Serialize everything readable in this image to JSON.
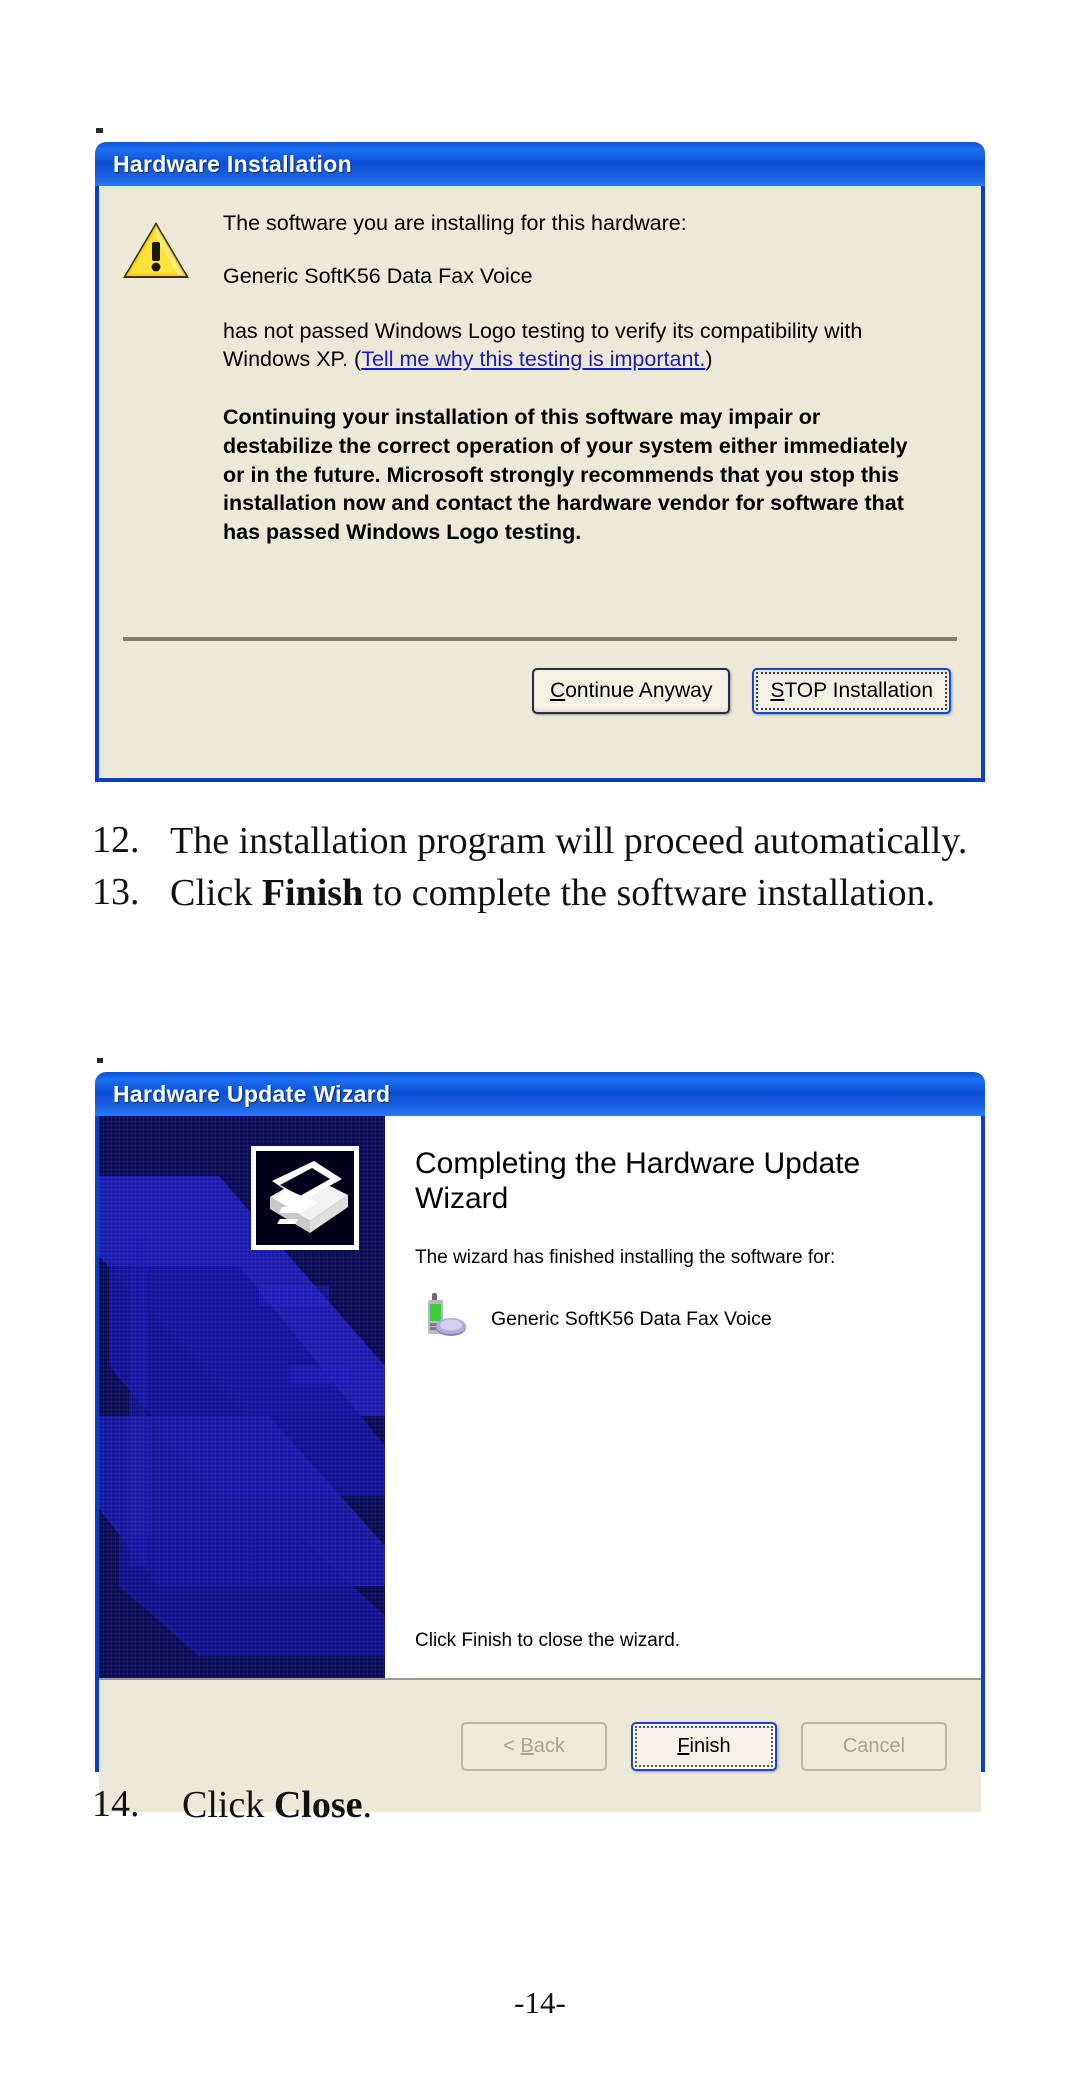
{
  "page": {
    "page_number": "-14-"
  },
  "dialog_hardware_installation": {
    "title": "Hardware Installation",
    "icon": "warning-triangle-icon",
    "line1": "The software you are installing for this hardware:",
    "device_name": "Generic SoftK56 Data Fax Voice",
    "line3_part1": "has not passed Windows Logo testing to verify its compatibility with Windows XP. (",
    "link_text": "Tell me why this testing is important.",
    "line3_part2": ")",
    "warning_paragraph": "Continuing your installation of this software may impair or destabilize the correct operation of your system either immediately or in the future. Microsoft strongly recommends that you stop this installation now and contact the hardware vendor for software that has passed Windows Logo testing.",
    "buttons": {
      "continue": {
        "accel": "C",
        "rest": "ontinue Anyway"
      },
      "stop": {
        "accel": "S",
        "rest": "TOP Installation"
      }
    }
  },
  "dialog_hardware_update_wizard": {
    "title": "Hardware Update Wizard",
    "banner_icon": "hardware-device-badge-icon",
    "heading": "Completing the Hardware Update Wizard",
    "subtitle": "The wizard has finished installing the software for:",
    "device_icon": "modem-device-icon",
    "device_name": "Generic SoftK56 Data Fax Voice",
    "footnote": "Click Finish to close the wizard.",
    "buttons": {
      "back": {
        "prefix": "< ",
        "accel": "B",
        "rest": "ack"
      },
      "finish": {
        "accel": "F",
        "rest": "inish"
      },
      "cancel": {
        "label": "Cancel"
      }
    }
  },
  "steps": [
    {
      "number": "12.",
      "text_before": "The installation program will proceed automatically.",
      "bold": "",
      "text_after": ""
    },
    {
      "number": "13.",
      "text_before": "Click ",
      "bold": "Finish",
      "text_after": " to complete the software installation."
    },
    {
      "number": "14.",
      "text_before": "Click ",
      "bold": "Close",
      "text_after": "."
    }
  ],
  "colors": {
    "titlebar_blue": "#0d4fd4",
    "dialog_face": "#ece9d8",
    "dialog_border": "#0a3fc4",
    "banner_navy": "#0b0b56",
    "banner_watermark": "#1d1db4",
    "link": "#1b1bb5",
    "warning_yellow": "#f5d020",
    "separator": "#82806b"
  }
}
